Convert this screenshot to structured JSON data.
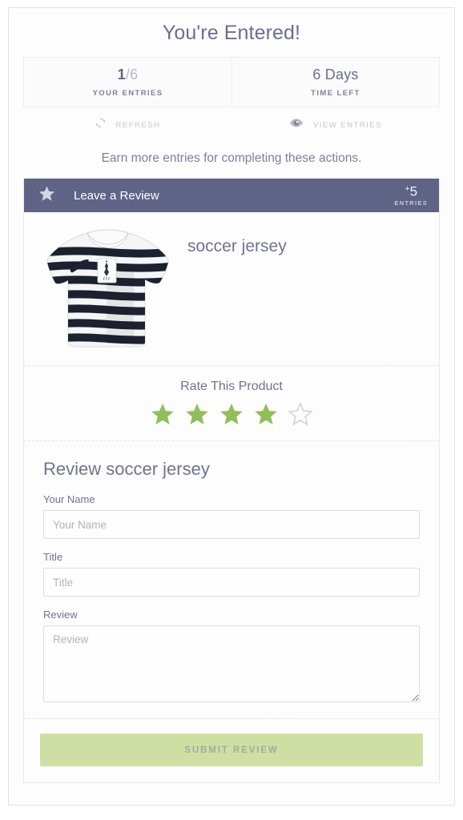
{
  "header": {
    "title": "You're Entered!"
  },
  "stats": [
    {
      "value_num": "1",
      "value_den": "/6",
      "label": "YOUR ENTRIES",
      "name": "your-entries"
    },
    {
      "value_num": "6 Days",
      "value_den": "",
      "label": "TIME LEFT",
      "name": "time-left"
    }
  ],
  "actions": [
    {
      "icon": "refresh-icon",
      "label": "REFRESH"
    },
    {
      "icon": "eye-icon",
      "label": "VIEW ENTRIES"
    }
  ],
  "subheading": "Earn more entries for completing these actions.",
  "task_card": {
    "icon": "star-icon",
    "title": "Leave a Review",
    "entries_plus": "+",
    "entries_value": "5",
    "entries_caption": "ENTRIES",
    "header_color": "#5f6386"
  },
  "product": {
    "name": "soccer jersey",
    "image_alt": "soccer-jersey-image"
  },
  "rating": {
    "title": "Rate This Product",
    "filled": 4,
    "total": 5,
    "filled_color": "#90bf5a",
    "empty_color": "#d5d6dd"
  },
  "form": {
    "title": "Review soccer jersey",
    "fields": [
      {
        "label": "Your Name",
        "placeholder": "Your Name",
        "value": "",
        "type": "text",
        "name": "your-name"
      },
      {
        "label": "Title",
        "placeholder": "Title",
        "value": "",
        "type": "text",
        "name": "title"
      },
      {
        "label": "Review",
        "placeholder": "Review",
        "value": "",
        "type": "textarea",
        "name": "review"
      }
    ]
  },
  "submit": {
    "label": "SUBMIT REVIEW",
    "background": "#cfdfa4",
    "text_color": "#a3ab9f"
  }
}
